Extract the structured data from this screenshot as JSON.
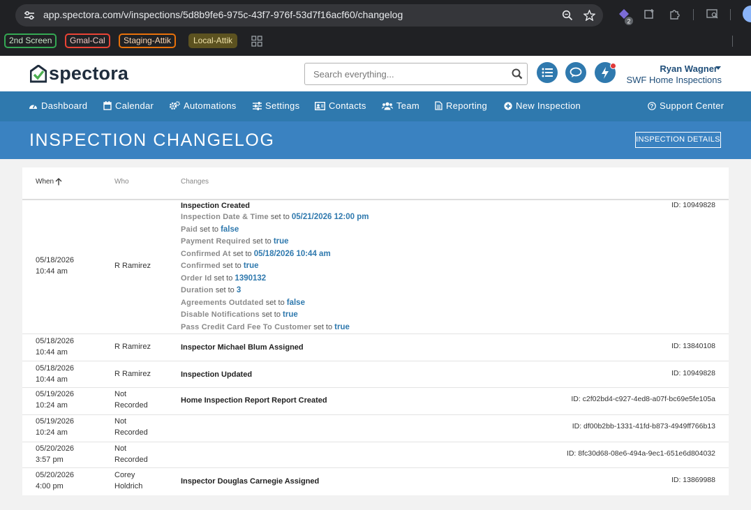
{
  "browser": {
    "url": "app.spectora.com/v/inspections/5d8b9fe6-975c-43f7-976f-53d7f16acf60/changelog",
    "extension_badge": "2",
    "bookmarks": [
      {
        "label": "2nd Screen",
        "color": "#34a853"
      },
      {
        "label": "Gmal-Cal",
        "color": "#ea4335"
      },
      {
        "label": "Staging-Attik",
        "color": "#e8710a"
      },
      {
        "label": "Local-Attik",
        "color": "#d4a72c"
      }
    ]
  },
  "header": {
    "logo_text": "spectora",
    "search_placeholder": "Search everything...",
    "user_name": "Ryan Wagner",
    "company": "SWF Home Inspections"
  },
  "nav": {
    "items": [
      {
        "label": "Dashboard",
        "icon": "dashboard-icon"
      },
      {
        "label": "Calendar",
        "icon": "calendar-icon"
      },
      {
        "label": "Automations",
        "icon": "cogs-icon"
      },
      {
        "label": "Settings",
        "icon": "sliders-icon"
      },
      {
        "label": "Contacts",
        "icon": "address-card-icon"
      },
      {
        "label": "Team",
        "icon": "users-icon"
      },
      {
        "label": "Reporting",
        "icon": "file-icon"
      },
      {
        "label": "New Inspection",
        "icon": "plus-circle-icon"
      }
    ],
    "support": "Support Center"
  },
  "page": {
    "title": "INSPECTION CHANGELOG",
    "details_button": "INSPECTION DETAILS"
  },
  "table": {
    "headers": {
      "when": "When",
      "who": "Who",
      "changes": "Changes"
    },
    "rows": [
      {
        "date": "05/18/2026",
        "time": "10:44 am",
        "who": [
          "R Ramirez"
        ],
        "title": "Inspection Created",
        "id": "ID: 10949828",
        "changes": [
          {
            "field": "Inspection Date & Time",
            "set_to": "set to",
            "value": "05/21/2026 12:00 pm"
          },
          {
            "field": "Paid",
            "set_to": "set to",
            "value": "false"
          },
          {
            "field": "Payment Required",
            "set_to": "set to",
            "value": "true"
          },
          {
            "field": "Confirmed At",
            "set_to": "set to",
            "value": "05/18/2026 10:44 am"
          },
          {
            "field": "Confirmed",
            "set_to": "set to",
            "value": "true"
          },
          {
            "field": "Order Id",
            "set_to": "set to",
            "value": "1390132"
          },
          {
            "field": "Duration",
            "set_to": "set to",
            "value": "3"
          },
          {
            "field": "Agreements Outdated",
            "set_to": "set to",
            "value": "false"
          },
          {
            "field": "Disable Notifications",
            "set_to": "set to",
            "value": "true"
          },
          {
            "field": "Pass Credit Card Fee To Customer",
            "set_to": "set to",
            "value": "true"
          }
        ]
      },
      {
        "date": "05/18/2026",
        "time": "10:44 am",
        "who": [
          "R Ramirez"
        ],
        "title": "Inspector Michael Blum Assigned",
        "id": "ID: 13840108",
        "changes": []
      },
      {
        "date": "05/18/2026",
        "time": "10:44 am",
        "who": [
          "R Ramirez"
        ],
        "title": "Inspection Updated",
        "id": "ID: 10949828",
        "changes": []
      },
      {
        "date": "05/19/2026",
        "time": "10:24 am",
        "who": [
          "Not",
          "Recorded"
        ],
        "title": "Home Inspection Report Report Created",
        "id": "ID: c2f02bd4-c927-4ed8-a07f-bc69e5fe105a",
        "changes": []
      },
      {
        "date": "05/19/2026",
        "time": "10:24 am",
        "who": [
          "Not",
          "Recorded"
        ],
        "title": "",
        "id": "ID: df00b2bb-1331-41fd-b873-4949ff766b13",
        "changes": []
      },
      {
        "date": "05/20/2026",
        "time": "3:57 pm",
        "who": [
          "Not",
          "Recorded"
        ],
        "title": "",
        "id": "ID: 8fc30d68-08e6-494a-9ec1-651e6d804032",
        "changes": []
      },
      {
        "date": "05/20/2026",
        "time": "4:00 pm",
        "who": [
          "Corey",
          "Holdrich"
        ],
        "title": "Inspector Douglas Carnegie Assigned",
        "id": "ID: 13869988",
        "changes": []
      }
    ]
  }
}
